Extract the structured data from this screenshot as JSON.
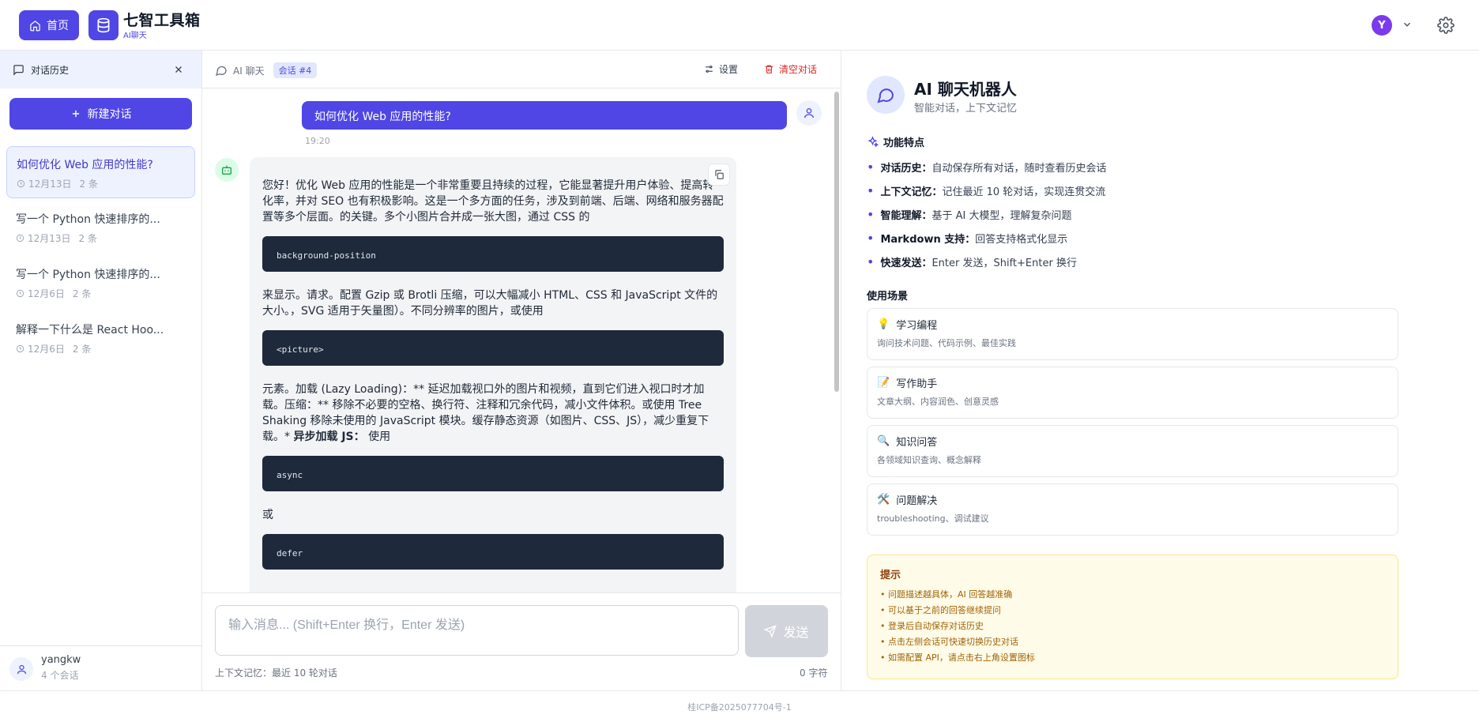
{
  "header": {
    "home_label": "首页",
    "brand_title": "七智工具箱",
    "brand_subtitle": "AI聊天",
    "avatar_letter": "Y"
  },
  "sidebar": {
    "title": "对话历史",
    "new_chat_label": "新建对话",
    "conversations": [
      {
        "title": "如何优化 Web 应用的性能?",
        "date": "12月13日",
        "count": "2 条"
      },
      {
        "title": "写一个 Python 快速排序的...",
        "date": "12月13日",
        "count": "2 条"
      },
      {
        "title": "写一个 Python 快速排序的...",
        "date": "12月6日",
        "count": "2 条"
      },
      {
        "title": "解释一下什么是 React Hoo...",
        "date": "12月6日",
        "count": "2 条"
      }
    ],
    "user": {
      "name": "yangkw",
      "sessions": "4 个会话"
    }
  },
  "chat": {
    "title": "AI 聊天",
    "session_badge": "会话 #4",
    "settings_label": "设置",
    "clear_label": "清空对话",
    "user_message": "如何优化 Web 应用的性能?",
    "user_time": "19:20",
    "bot": {
      "p1": "您好！优化 Web 应用的性能是一个非常重要且持续的过程，它能显著提升用户体验、提高转化率，并对 SEO 也有积极影响。这是一个多方面的任务，涉及到前端、后端、网络和服务器配置等多个层面。的关键。多个小图片合并成一张大图，通过 CSS 的",
      "code1": "background-position",
      "p2": "来显示。请求。配置 Gzip 或 Brotli 压缩，可以大幅减小 HTML、CSS 和 JavaScript 文件的大小。，SVG 适用于矢量图）。不同分辨率的图片，或使用",
      "code2": "<picture>",
      "p3a": "元素。加载 (Lazy Loading)：** 延迟加载视口外的图片和视频，直到它们进入视口时才加载。压缩：** 移除不必要的空格、换行符、注释和冗余代码，减小文件体积。或使用 Tree Shaking 移除未使用的 JavaScript 模块。缓存静态资源（如图片、CSS、JS），减少重复下载。* ",
      "p3b": "异步加载 JS：",
      "p3c": " 使用",
      "code3": "async",
      "p4": "或",
      "code4": "defer"
    },
    "input_placeholder": "输入消息... (Shift+Enter 换行，Enter 发送)",
    "send_label": "发送",
    "context_note": "上下文记忆：最近 10 轮对话",
    "char_count": "0 字符"
  },
  "info": {
    "title": "AI 聊天机器人",
    "subtitle": "智能对话，上下文记忆",
    "features_title": "功能特点",
    "features": [
      {
        "name": "对话历史：",
        "desc": "自动保存所有对话，随时查看历史会话"
      },
      {
        "name": "上下文记忆：",
        "desc": "记住最近 10 轮对话，实现连贯交流"
      },
      {
        "name": "智能理解：",
        "desc": "基于 AI 大模型，理解复杂问题"
      },
      {
        "name": "Markdown 支持：",
        "desc": "回答支持格式化显示"
      },
      {
        "name": "快速发送：",
        "desc": "Enter 发送，Shift+Enter 换行"
      }
    ],
    "scenarios_title": "使用场景",
    "scenarios": [
      {
        "icon": "💡",
        "title": "学习编程",
        "desc": "询问技术问题、代码示例、最佳实践"
      },
      {
        "icon": "📝",
        "title": "写作助手",
        "desc": "文章大纲、内容润色、创意灵感"
      },
      {
        "icon": "🔍",
        "title": "知识问答",
        "desc": "各领域知识查询、概念解释"
      },
      {
        "icon": "🛠️",
        "title": "问题解决",
        "desc": "troubleshooting、调试建议"
      }
    ],
    "tips_title": "提示",
    "tips": [
      "• 问题描述越具体，AI 回答越准确",
      "• 可以基于之前的回答继续提问",
      "• 登录后自动保存对话历史",
      "• 点击左侧会话可快速切换历史对话",
      "• 如需配置 API，请点击右上角设置图标"
    ]
  },
  "footer": {
    "icp": "桂ICP备2025077704号-1"
  }
}
